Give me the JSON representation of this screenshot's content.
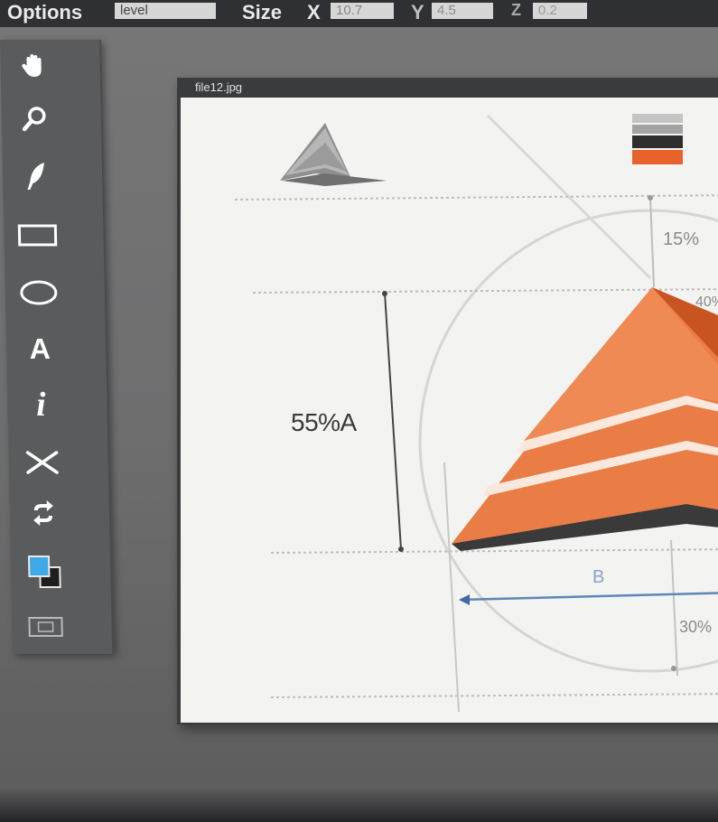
{
  "options_bar": {
    "title": "Options",
    "field_value": "level",
    "size_label": "Size",
    "x_label": "X",
    "x_value": "10.7",
    "y_label": "Y",
    "y_value": "4.5",
    "z_label": "Z",
    "z_value": "0.2"
  },
  "palette": {
    "tools": [
      {
        "name": "hand-tool",
        "icon": "hand-icon"
      },
      {
        "name": "zoom-tool",
        "icon": "magnifier-icon"
      },
      {
        "name": "feather-tool",
        "icon": "feather-icon"
      },
      {
        "name": "rectangle-tool",
        "icon": "rectangle-icon"
      },
      {
        "name": "ellipse-tool",
        "icon": "ellipse-icon"
      },
      {
        "name": "text-tool",
        "icon": "text-A-icon",
        "glyph": "A"
      },
      {
        "name": "info-tool",
        "icon": "italic-i-icon",
        "glyph": "i"
      },
      {
        "name": "scissors-tool",
        "icon": "scissors-icon"
      },
      {
        "name": "swap-tool",
        "icon": "swap-arrows-icon"
      },
      {
        "name": "color-swatch",
        "icon": "color-swatch-icon"
      },
      {
        "name": "screen-mode-tool",
        "icon": "screen-mode-icon"
      }
    ],
    "fg_color": "#3ea9e6",
    "bg_color": "#1e1e1e"
  },
  "document": {
    "filename": "file12.jpg",
    "left_measure": "55%A",
    "top_right_measure": "15%",
    "bottom_measure_left": "B",
    "bottom_right_measure": "30%",
    "right_side_measure": "40%",
    "accent_color": "#e8632c",
    "grey_pyramid_color": "#9a9a9a"
  }
}
